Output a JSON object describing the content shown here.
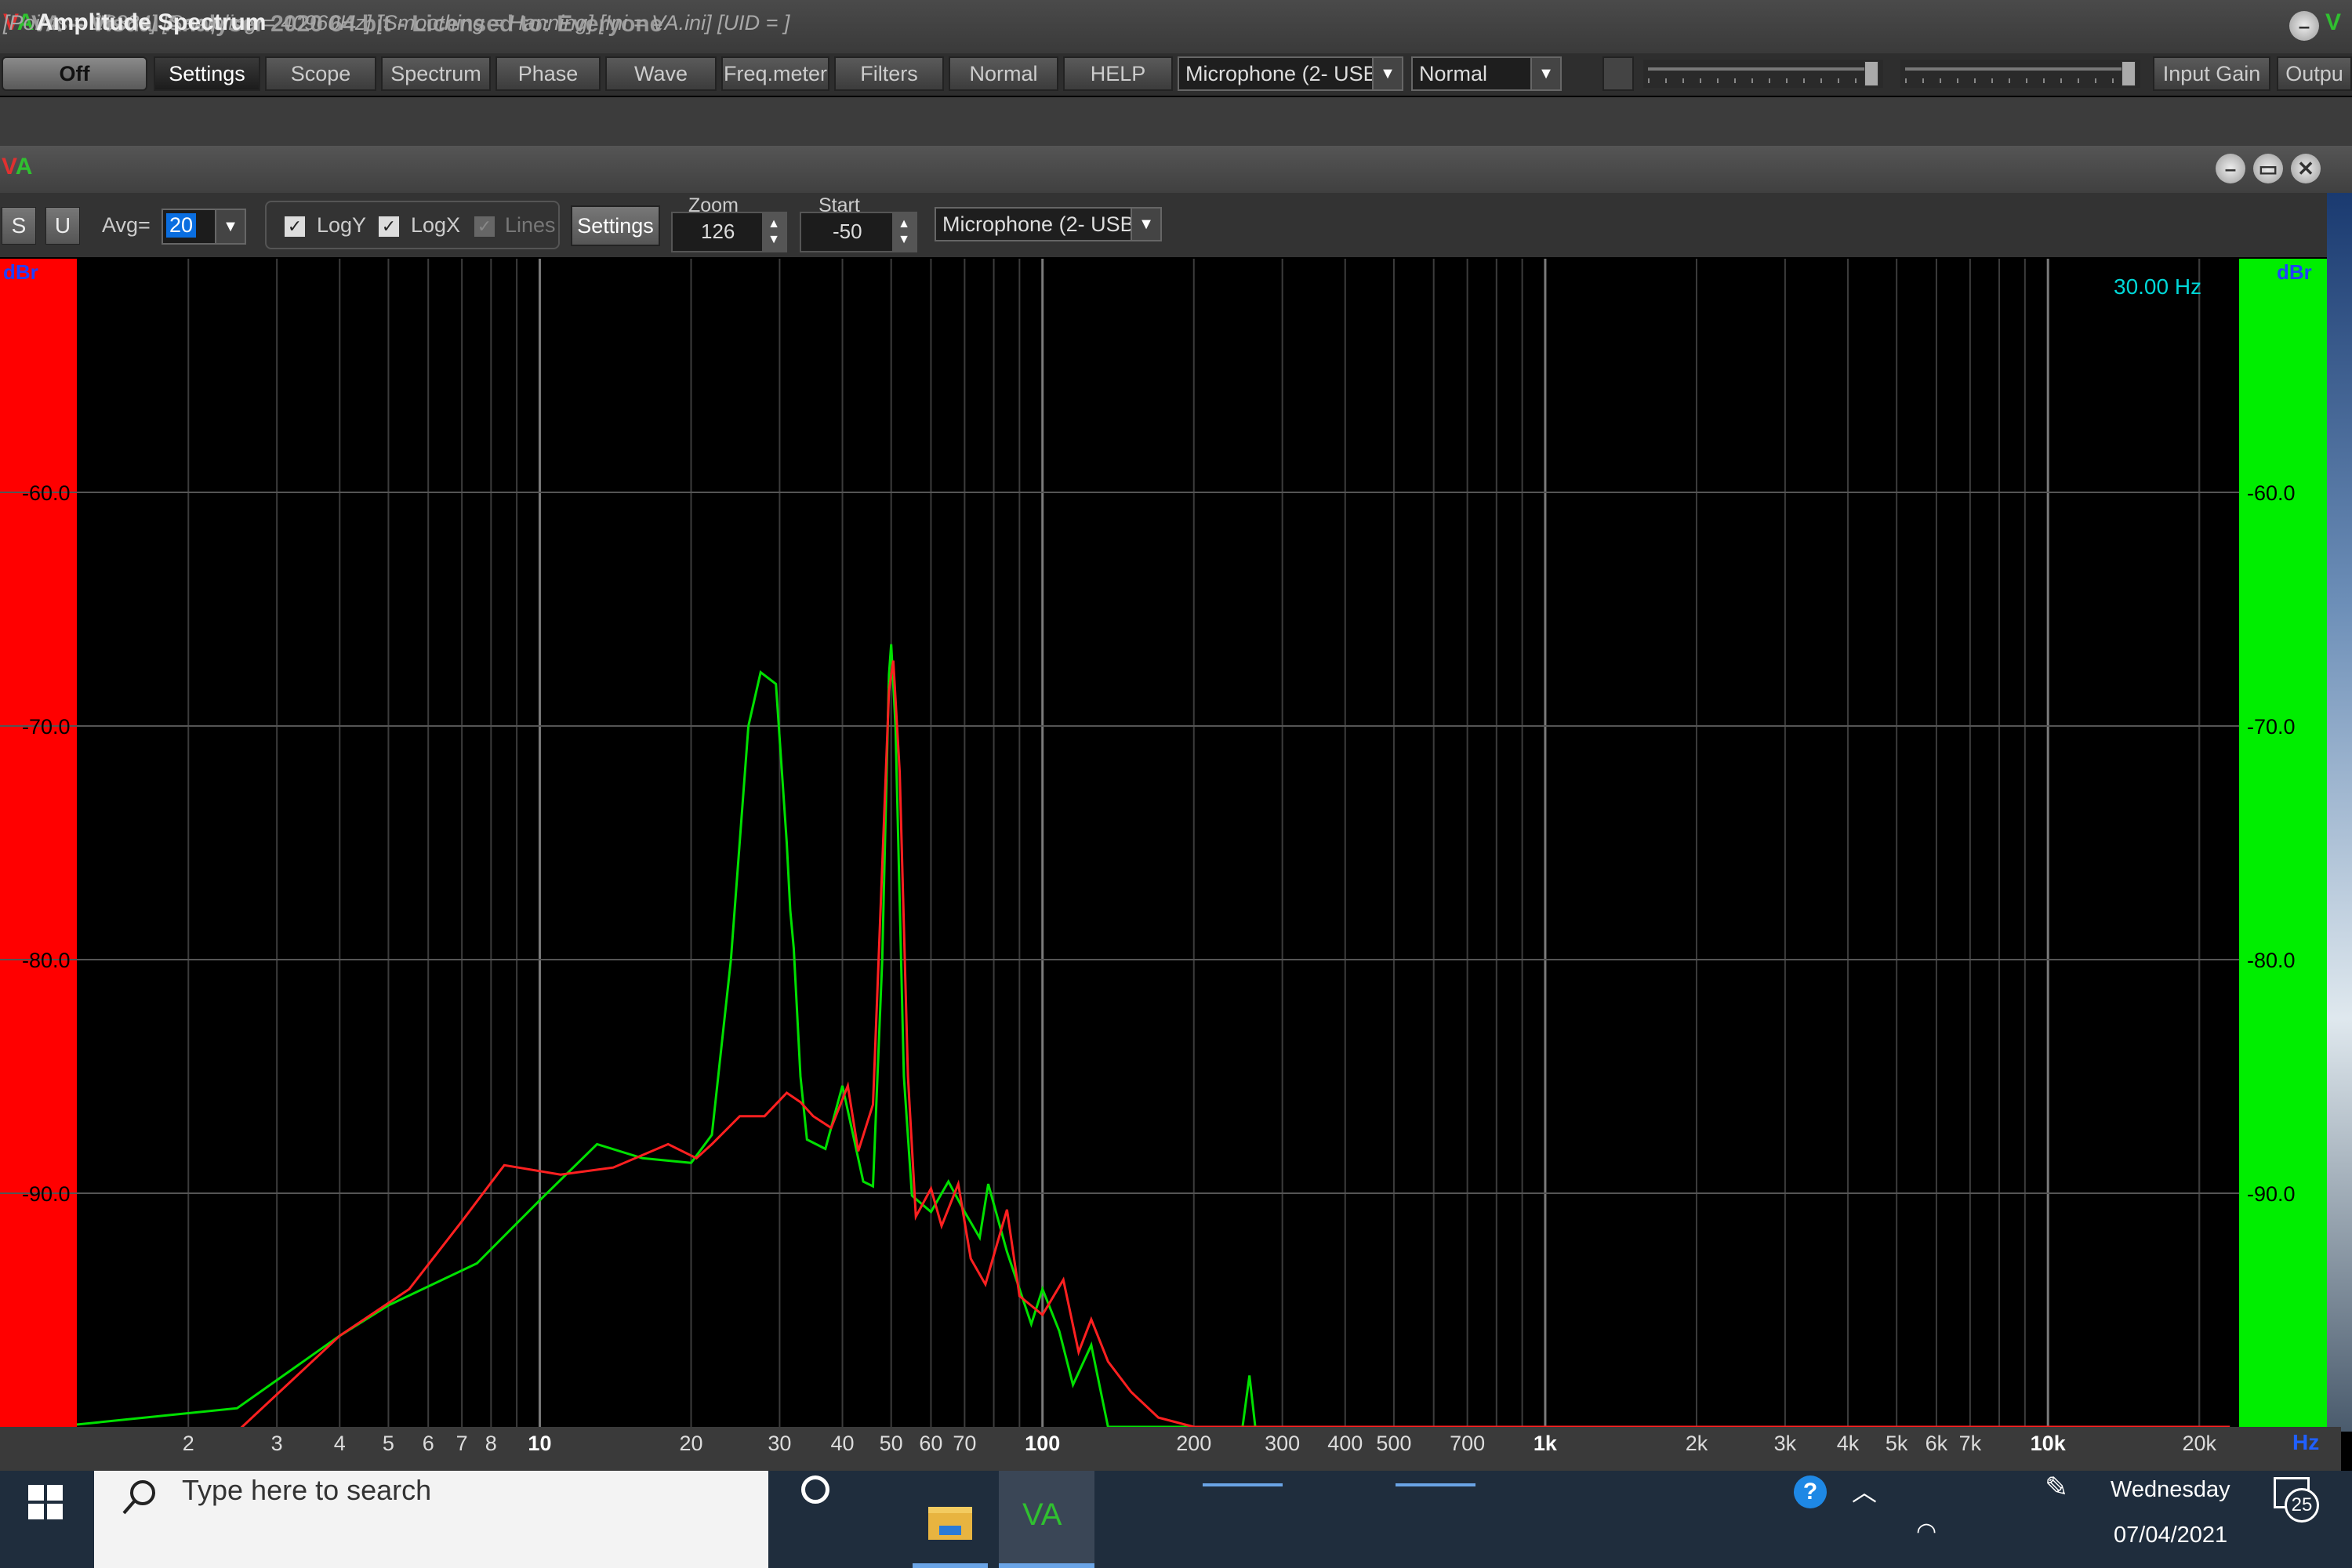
{
  "window": {
    "title": "VA -- Visual Analyser 2020 64 bit - Licensed to: Everyone",
    "logo": {
      "v": "V",
      "a": "A"
    }
  },
  "toolbar": {
    "off": "Off",
    "items": [
      "Settings",
      "Scope",
      "Spectrum",
      "Phase",
      "Wave",
      "Freq.meter",
      "Filters",
      "Normal",
      "HELP"
    ],
    "input_device": "Microphone (2- USB",
    "mode": "Normal",
    "input_gain": "Input Gain",
    "output": "Outpu"
  },
  "infobar": "[Points = 16384]  [Sampling = 40960Hz]  [Smoothing = Hanning]  [Ini = VA.ini]  [UID = ]",
  "spectrum_window": {
    "title": "Amplitude Spectrum",
    "s_btn": "S",
    "u_btn": "U",
    "avg_label": "Avg=",
    "avg_value": "20",
    "logy": "LogY",
    "logx": "LogX",
    "lines": "Lines",
    "settings": "Settings",
    "zoom_label": "Zoom",
    "zoom_value": "126",
    "start_label": "Start",
    "start_value": "-50",
    "device": "Microphone (2- USB"
  },
  "chart_data": {
    "type": "line",
    "y_unit": "dBr",
    "x_unit": "Hz",
    "cursor_readout": "30.00 Hz",
    "ylim": [
      -100,
      -50
    ],
    "x_log": true,
    "xlim": [
      1.2,
      24000
    ],
    "y_ticks": [
      "-60.0",
      "-70.0",
      "-80.0",
      "-90.0"
    ],
    "x_ticks": [
      {
        "v": 2,
        "l": "2"
      },
      {
        "v": 3,
        "l": "3"
      },
      {
        "v": 4,
        "l": "4"
      },
      {
        "v": 5,
        "l": "5"
      },
      {
        "v": 6,
        "l": "6"
      },
      {
        "v": 7,
        "l": "7"
      },
      {
        "v": 8,
        "l": "8"
      },
      {
        "v": 10,
        "l": "10",
        "bold": true
      },
      {
        "v": 20,
        "l": "20"
      },
      {
        "v": 30,
        "l": "30"
      },
      {
        "v": 40,
        "l": "40"
      },
      {
        "v": 50,
        "l": "50"
      },
      {
        "v": 60,
        "l": "60"
      },
      {
        "v": 70,
        "l": "70"
      },
      {
        "v": 100,
        "l": "100",
        "bold": true
      },
      {
        "v": 200,
        "l": "200"
      },
      {
        "v": 300,
        "l": "300"
      },
      {
        "v": 400,
        "l": "400"
      },
      {
        "v": 500,
        "l": "500"
      },
      {
        "v": 700,
        "l": "700"
      },
      {
        "v": 1000,
        "l": "1k",
        "bold": true
      },
      {
        "v": 2000,
        "l": "2k"
      },
      {
        "v": 3000,
        "l": "3k"
      },
      {
        "v": 4000,
        "l": "4k"
      },
      {
        "v": 5000,
        "l": "5k"
      },
      {
        "v": 6000,
        "l": "6k"
      },
      {
        "v": 7000,
        "l": "7k"
      },
      {
        "v": 10000,
        "l": "10k",
        "bold": true
      },
      {
        "v": 20000,
        "l": "20k"
      }
    ],
    "series": [
      {
        "color": "#00e000",
        "points": [
          [
            1.2,
            -99.9
          ],
          [
            2.5,
            -99.2
          ],
          [
            4,
            -96.1
          ],
          [
            5,
            -94.8
          ],
          [
            7.5,
            -93.0
          ],
          [
            10,
            -90.3
          ],
          [
            13,
            -87.9
          ],
          [
            16,
            -88.5
          ],
          [
            20,
            -88.7
          ],
          [
            22,
            -87.5
          ],
          [
            24,
            -80
          ],
          [
            26,
            -70
          ],
          [
            27.5,
            -67.7
          ],
          [
            29.5,
            -68.2
          ],
          [
            31,
            -75
          ],
          [
            31.5,
            -77.9
          ],
          [
            32,
            -79.5
          ],
          [
            33,
            -85
          ],
          [
            34,
            -87.7
          ],
          [
            37,
            -88.1
          ],
          [
            40,
            -85.4
          ],
          [
            44,
            -89.5
          ],
          [
            46,
            -89.7
          ],
          [
            48,
            -80
          ],
          [
            49.5,
            -67.8
          ],
          [
            50,
            -66.5
          ],
          [
            51,
            -70
          ],
          [
            53,
            -85
          ],
          [
            55,
            -90.1
          ],
          [
            60,
            -90.8
          ],
          [
            65,
            -89.5
          ],
          [
            70,
            -90.8
          ],
          [
            75,
            -91.9
          ],
          [
            78,
            -89.6
          ],
          [
            85,
            -92.5
          ],
          [
            95,
            -95.6
          ],
          [
            100,
            -94.1
          ],
          [
            108,
            -95.9
          ],
          [
            115,
            -98.2
          ],
          [
            125,
            -96.5
          ],
          [
            135,
            -100
          ],
          [
            150,
            -100
          ],
          [
            250,
            -100
          ],
          [
            258,
            -97.8
          ],
          [
            265,
            -100
          ],
          [
            2000,
            -100
          ],
          [
            23000,
            -100
          ]
        ]
      },
      {
        "color": "#ff2020",
        "points": [
          [
            1.2,
            -100.5
          ],
          [
            2.5,
            -100.2
          ],
          [
            4,
            -96.1
          ],
          [
            5.5,
            -94.1
          ],
          [
            7,
            -91.2
          ],
          [
            8.5,
            -88.8
          ],
          [
            11,
            -89.2
          ],
          [
            14,
            -88.9
          ],
          [
            18,
            -87.9
          ],
          [
            20.5,
            -88.5
          ],
          [
            22,
            -87.9
          ],
          [
            25,
            -86.7
          ],
          [
            28,
            -86.7
          ],
          [
            31,
            -85.7
          ],
          [
            33,
            -86.1
          ],
          [
            35,
            -86.7
          ],
          [
            38,
            -87.2
          ],
          [
            41,
            -85.4
          ],
          [
            43,
            -88.2
          ],
          [
            46,
            -86.2
          ],
          [
            48,
            -76
          ],
          [
            49.5,
            -68.5
          ],
          [
            50.5,
            -67.2
          ],
          [
            52,
            -72
          ],
          [
            54,
            -85
          ],
          [
            56,
            -91
          ],
          [
            60,
            -89.8
          ],
          [
            63,
            -91.4
          ],
          [
            68,
            -89.6
          ],
          [
            72,
            -92.8
          ],
          [
            77,
            -93.9
          ],
          [
            85,
            -90.7
          ],
          [
            90,
            -94.4
          ],
          [
            100,
            -95.2
          ],
          [
            110,
            -93.7
          ],
          [
            118,
            -96.8
          ],
          [
            125,
            -95.4
          ],
          [
            135,
            -97.2
          ],
          [
            150,
            -98.5
          ],
          [
            170,
            -99.6
          ],
          [
            200,
            -100
          ],
          [
            23000,
            -100
          ]
        ]
      }
    ]
  },
  "taskbar": {
    "search_placeholder": "Type here to search",
    "va_icon": "VA",
    "day": "Wednesday",
    "date": "07/04/2021",
    "notifications": "25"
  }
}
